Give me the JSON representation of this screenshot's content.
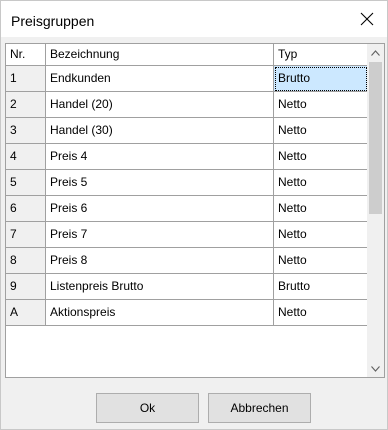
{
  "window": {
    "title": "Preisgruppen"
  },
  "table": {
    "headers": {
      "nr": "Nr.",
      "bezeichnung": "Bezeichnung",
      "typ": "Typ"
    },
    "rows": [
      {
        "nr": "1",
        "bezeichnung": "Endkunden",
        "typ": "Brutto"
      },
      {
        "nr": "2",
        "bezeichnung": "Handel (20)",
        "typ": "Netto"
      },
      {
        "nr": "3",
        "bezeichnung": "Handel (30)",
        "typ": "Netto"
      },
      {
        "nr": "4",
        "bezeichnung": "Preis 4",
        "typ": "Netto"
      },
      {
        "nr": "5",
        "bezeichnung": "Preis 5",
        "typ": "Netto"
      },
      {
        "nr": "6",
        "bezeichnung": "Preis 6",
        "typ": "Netto"
      },
      {
        "nr": "7",
        "bezeichnung": "Preis 7",
        "typ": "Netto"
      },
      {
        "nr": "8",
        "bezeichnung": "Preis 8",
        "typ": "Netto"
      },
      {
        "nr": "9",
        "bezeichnung": "Listenpreis Brutto",
        "typ": "Brutto"
      },
      {
        "nr": "A",
        "bezeichnung": "Aktionspreis",
        "typ": "Netto"
      }
    ]
  },
  "buttons": {
    "ok": "Ok",
    "cancel": "Abbrechen"
  },
  "colors": {
    "selection": "#cce8ff",
    "gridline": "#a0a0a0",
    "dialog_bg": "#f0f0f0"
  },
  "icons": {
    "close": "close-icon",
    "scroll_up": "chevron-up-icon",
    "scroll_down": "chevron-down-icon"
  }
}
